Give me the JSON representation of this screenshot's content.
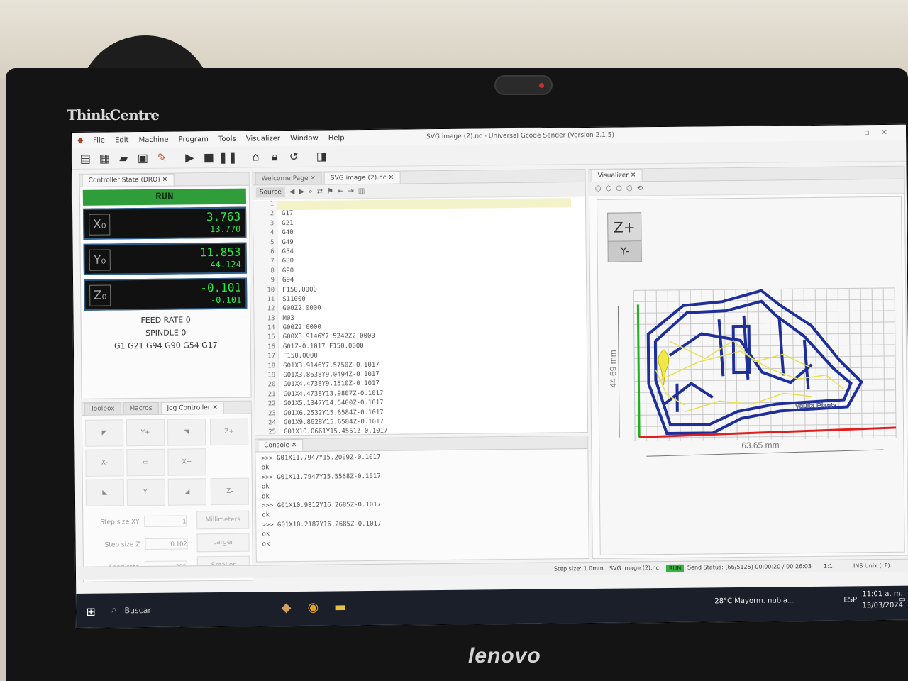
{
  "monitor": {
    "top_brand": "ThinkCentre",
    "bottom_brand": "lenovo"
  },
  "app": {
    "title": "SVG image (2).nc - Universal Gcode Sender (Version 2.1.5)",
    "menu": [
      "File",
      "Edit",
      "Machine",
      "Program",
      "Tools",
      "Visualizer",
      "Window",
      "Help"
    ]
  },
  "toolbar": {
    "icons": [
      "gcode-file-icon",
      "open-file-icon",
      "folder-icon",
      "save-icon",
      "connect-icon",
      "play-icon",
      "stop-icon",
      "pause-icon",
      "home-icon",
      "unlock-icon",
      "reset-icon",
      "probe-icon"
    ]
  },
  "dro": {
    "tab": "Controller State (DRO)",
    "state": "RUN",
    "axes": [
      {
        "label": "X₀",
        "work": "3.763",
        "machine": "13.770"
      },
      {
        "label": "Y₀",
        "work": "11.853",
        "machine": "44.124"
      },
      {
        "label": "Z₀",
        "work": "-0.101",
        "machine": "-0.101"
      }
    ],
    "feed_rate": "FEED RATE 0",
    "spindle": "SPINDLE 0",
    "gcode_state": "G1 G21 G94 G90 G54 G17"
  },
  "jog": {
    "tabs": [
      "Toolbox",
      "Macros",
      "Jog Controller"
    ],
    "buttons": {
      "ul": "◤",
      "yplus": "Y+",
      "ur": "◥",
      "zplus": "Z+",
      "xminus": "X-",
      "center": "▭",
      "xplus": "X+",
      "ll": "◣",
      "yminus": "Y-",
      "lr": "◢",
      "zminus": "Z-"
    },
    "step_xy_label": "Step size XY",
    "step_xy_value": "1",
    "step_z_label": "Step size Z",
    "step_z_value": "0.102",
    "feed_label": "Feed rate",
    "feed_value": "200",
    "units_button": "Millimeters",
    "larger_button": "Larger",
    "smaller_button": "Smaller"
  },
  "editor": {
    "tabs": [
      "Welcome Page",
      "SVG image (2).nc"
    ],
    "source_button": "Source",
    "lines": [
      "",
      "G17",
      "G21",
      "G40",
      "G49",
      "G54",
      "G80",
      "G90",
      "G94",
      "F150.0000",
      "S11000",
      "G00Z2.0000",
      "M03",
      "G00Z2.0000",
      "G00X3.9146Y7.5242Z2.0000",
      "G01Z-0.1017 F150.0000",
      "F150.0000",
      "G01X3.9146Y7.5750Z-0.1017",
      "G01X3.8638Y9.0494Z-0.1017",
      "G01X4.4738Y9.1510Z-0.1017",
      "G01X4.4738Y13.9807Z-0.1017",
      "G01X5.1347Y14.5400Z-0.1017",
      "G01X6.2532Y15.6584Z-0.1017",
      "G01X9.8628Y15.6584Z-0.1017",
      "G01X10.0661Y15.4551Z-0.1017"
    ]
  },
  "console": {
    "tab": "Console",
    "lines": [
      ">>> G01X11.7947Y15.2009Z-0.1017",
      "ok",
      ">>> G01X11.7947Y15.5568Z-0.1017",
      "ok",
      "ok",
      ">>> G01X10.9812Y16.2685Z-0.1017",
      "ok",
      ">>> G01X10.2187Y16.2685Z-0.1017",
      "ok",
      "ok"
    ]
  },
  "visualizer": {
    "tab": "Visualizer",
    "cube_z": "Z+",
    "cube_y": "Y-",
    "height_label": "44.69 mm",
    "width_label": "63.65 mm",
    "pcb_text": "Vaulta Planta"
  },
  "statusbar": {
    "step_size": "Step size: 1.0mm",
    "file": "SVG image (2).nc",
    "run": "RUN",
    "send_status": "Send Status: (66/5125) 00:00:20 / 00:26:03",
    "zoom": "1:1",
    "mode": "INS  Unix (LF)"
  },
  "taskbar": {
    "search_placeholder": "Buscar",
    "weather": "28°C  Mayorm. nubla...",
    "lang": "ESP",
    "time": "11:01 a. m.",
    "date": "15/03/2024"
  },
  "colors": {
    "run_green": "#2f9e3a",
    "dro_digits": "#2ee84a",
    "pcb_blue": "#1f2f9a",
    "toolpath_yellow": "#e8e04a",
    "x_axis": "#e02020",
    "y_axis": "#20b020"
  }
}
